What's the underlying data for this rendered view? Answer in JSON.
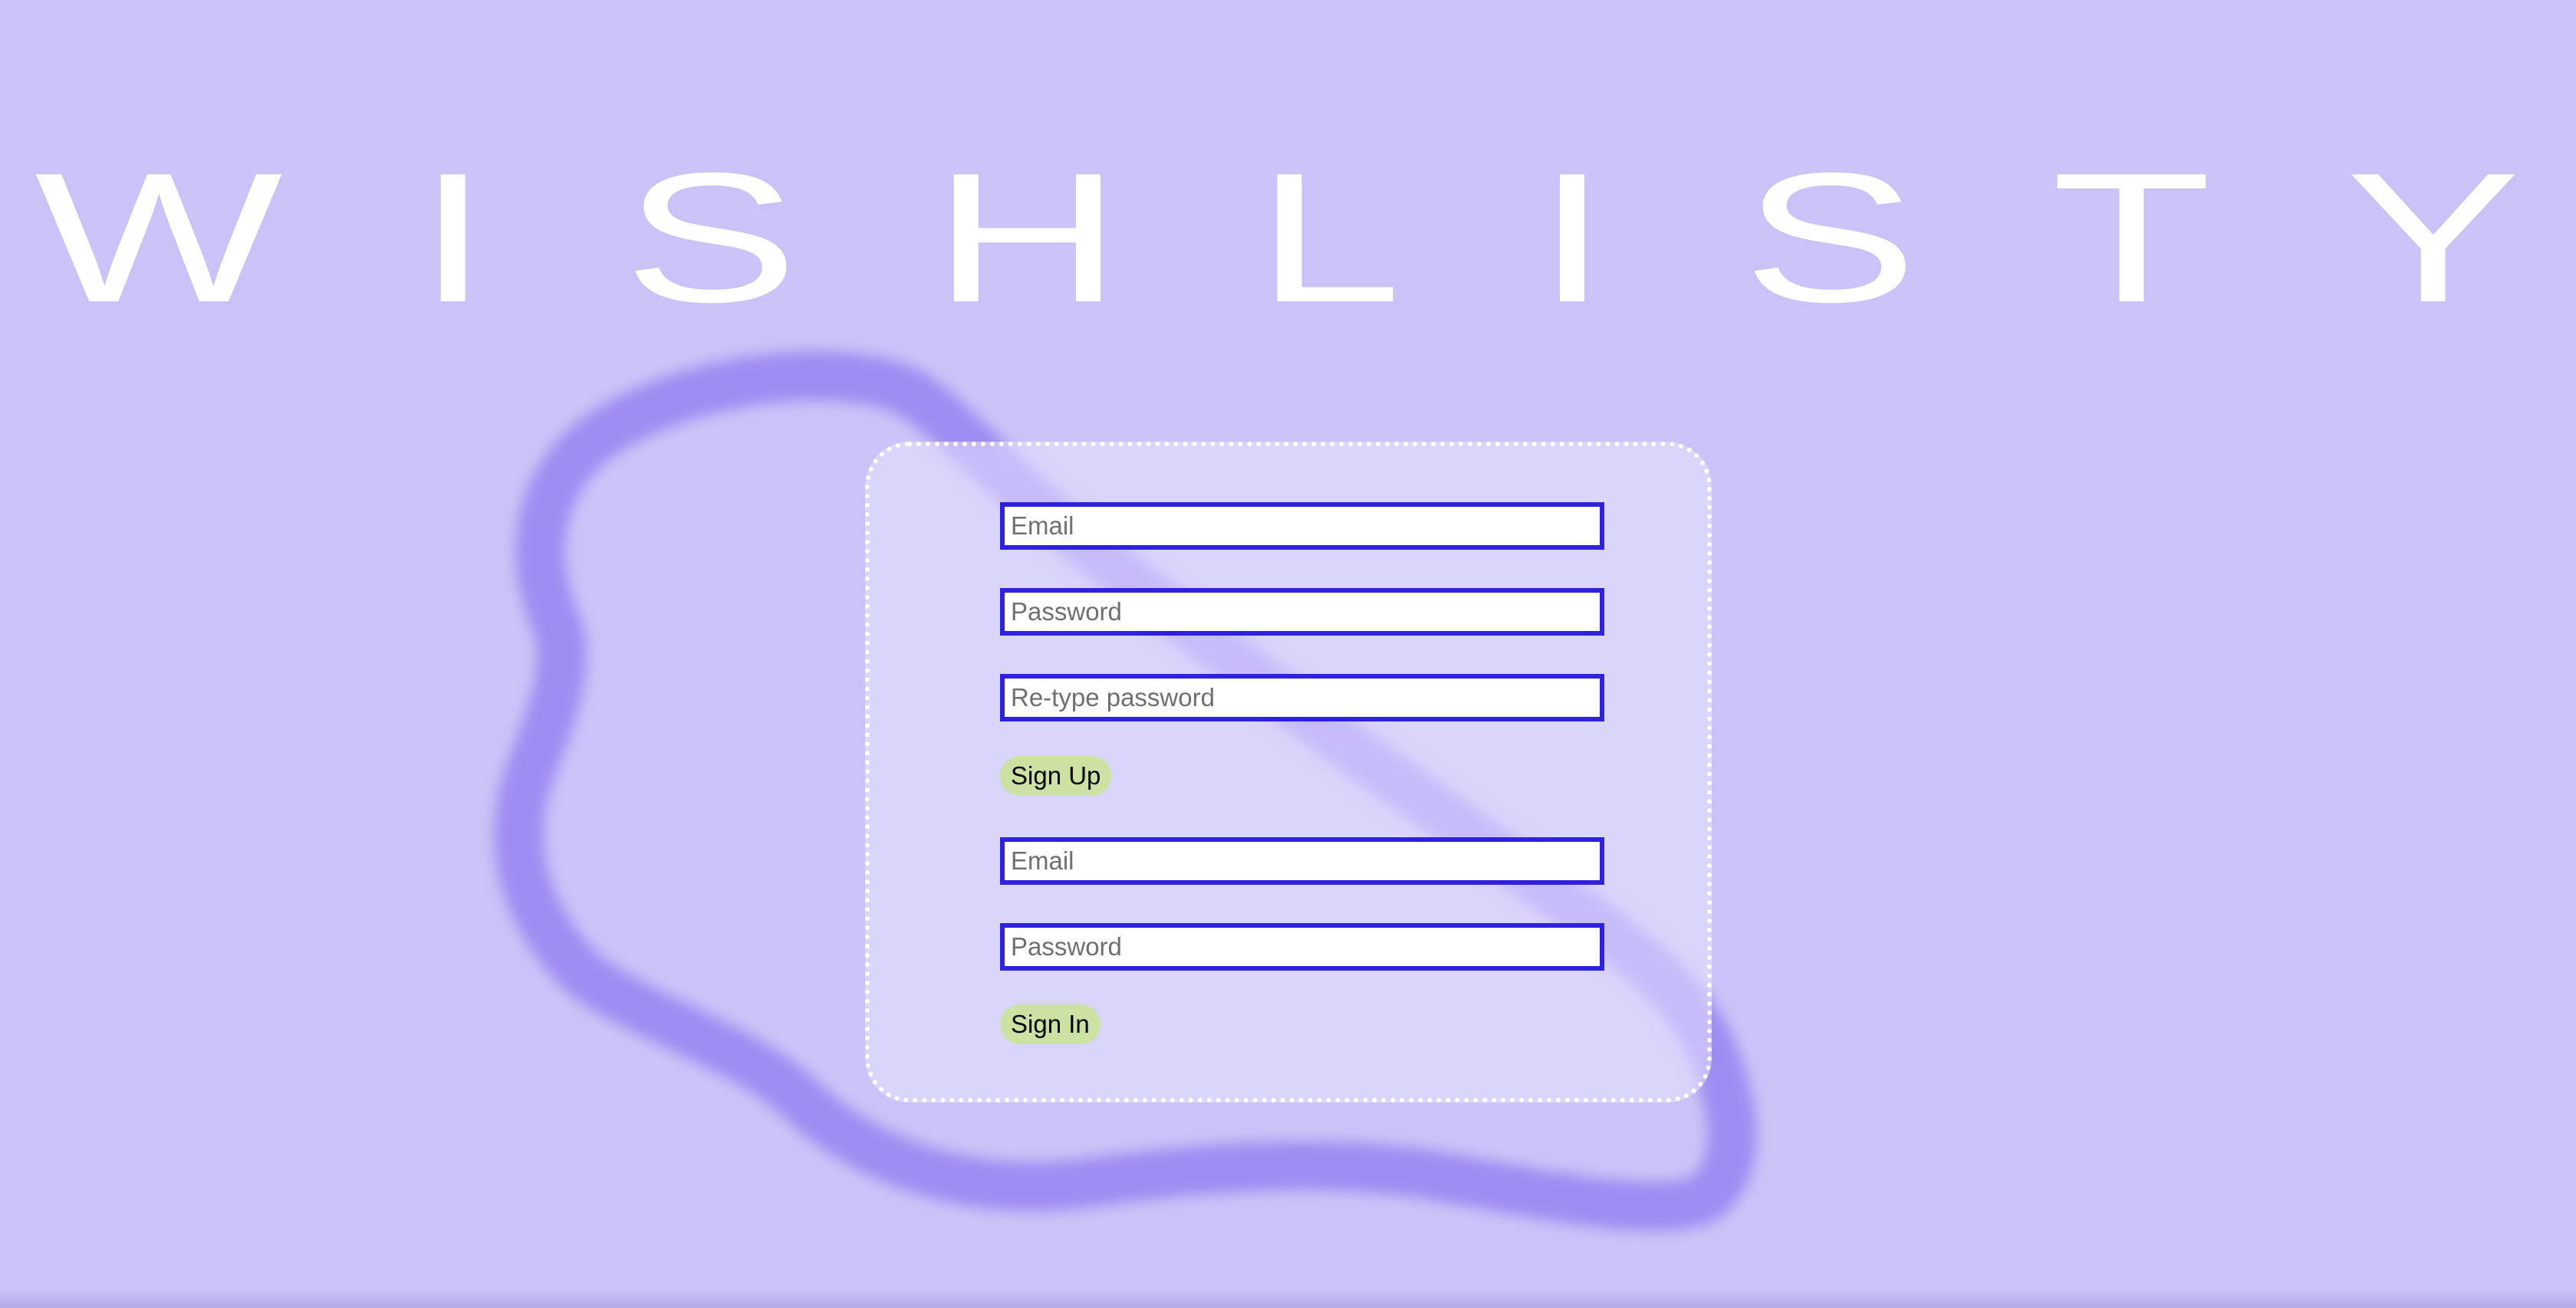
{
  "app": {
    "logo_text": "WISHLISTY"
  },
  "colors": {
    "background": "#cbc3f7",
    "logo": "#ffffff",
    "brush_stroke": "#9a86f2",
    "card_border": "#ffffff",
    "field_border": "#2f22de",
    "button_background": "#cbe2a2"
  },
  "signup": {
    "email_placeholder": "Email",
    "password_placeholder": "Password",
    "retype_placeholder": "Re-type password",
    "button_label": "Sign Up"
  },
  "signin": {
    "email_placeholder": "Email",
    "password_placeholder": "Password",
    "button_label": "Sign In"
  }
}
